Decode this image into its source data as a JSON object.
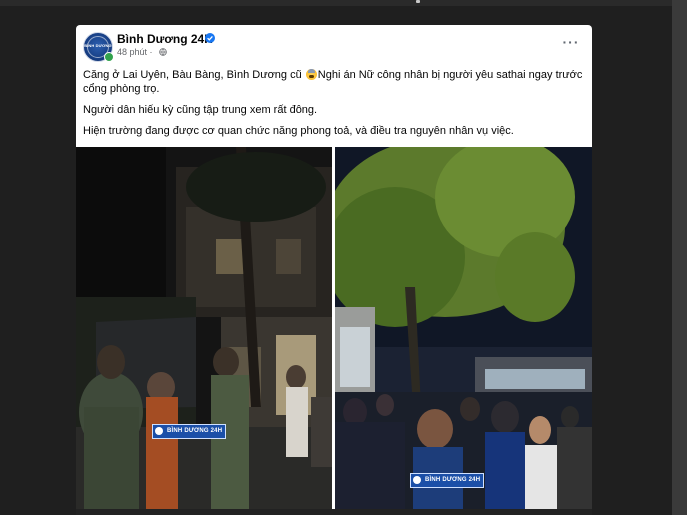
{
  "post": {
    "page_name": "Bình Dương 24H",
    "time": "48 phút",
    "time_separator": "·",
    "avatar_text": "BÌNH DƯƠNG",
    "more_label": "···",
    "paragraph1_part1": "Căng ở Lai Uyên, Bàu Bàng, Bình Dương cũ ",
    "paragraph1_part2": "Nghi án Nữ công nhân bị người yêu sathai ngay trước cổng phòng trọ.",
    "paragraph2": "Người dân hiếu kỳ cũng tập trung xem rất đông.",
    "paragraph3": "Hiện trường đang được cơ quan chức năng phong toả, và điều tra nguyên nhân vụ việc."
  },
  "photos": {
    "left_watermark": "BÌNH DƯƠNG 24H",
    "right_watermark": "BÌNH DƯƠNG 24H"
  },
  "colors": {
    "verified": "#1877f2",
    "online": "#31a24c",
    "watermark": "#1b4fa8"
  },
  "icons": [
    "verified-badge-icon",
    "globe-icon",
    "more-options-icon",
    "emoji-fearful-icon"
  ]
}
